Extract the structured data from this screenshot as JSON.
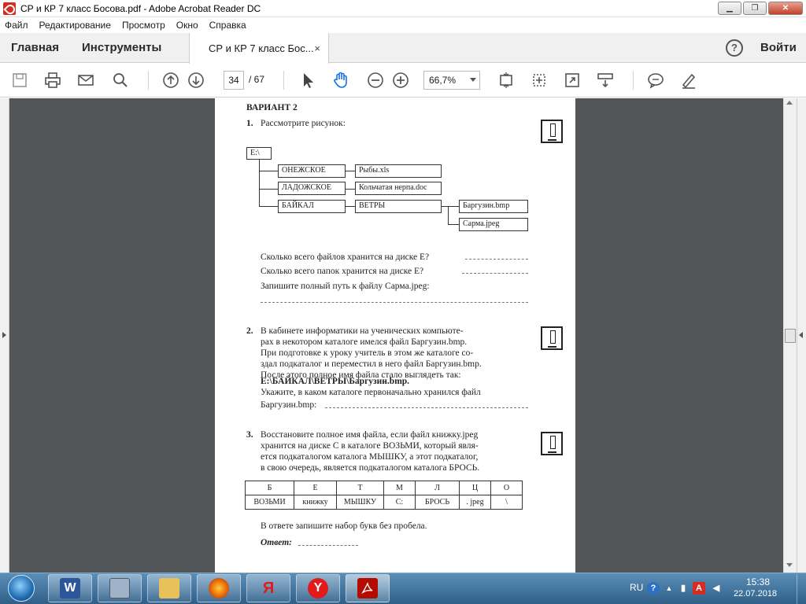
{
  "window": {
    "title": "СР и КР 7 класс Босова.pdf - Adobe Acrobat Reader DC"
  },
  "menu": [
    "Файл",
    "Редактирование",
    "Просмотр",
    "Окно",
    "Справка"
  ],
  "nav": {
    "home": "Главная",
    "tools": "Инструменты",
    "tab": "СР и КР 7 класс Бос...",
    "tab_close": "×",
    "help": "?",
    "signin": "Войти"
  },
  "toolbar": {
    "page_current": "34",
    "page_total": "/ 67",
    "zoom": "66,7%"
  },
  "doc": {
    "variant": "ВАРИАНТ  2",
    "q1": {
      "num": "1.",
      "text": "Рассмотрите рисунок:",
      "tree": {
        "root": "E:\\",
        "folders": [
          "ОНЕЖСКОЕ",
          "ЛАДОЖСКОЕ",
          "БАЙКАЛ"
        ],
        "files": [
          "Рыбы.xls",
          "Кольчатая нерпа.doc"
        ],
        "subfolder": "ВЕТРЫ",
        "subfiles": [
          "Баргузин.bmp",
          "Сарма.jpeg"
        ]
      },
      "lines": [
        "Сколько всего файлов хранится на диске E?",
        "Сколько всего папок хранится на диске E?",
        "Запишите полный путь к файлу Сарма.jpeg:"
      ]
    },
    "q2": {
      "num": "2.",
      "lines": [
        "В кабинете информатики на ученических компьюте-",
        "рах в некотором каталоге имелся файл Баргузин.bmp.",
        "При подготовке к уроку учитель в этом же каталоге со-",
        "здал подкаталог и переместил в него файл Баргузин.bmp.",
        "После этого полное имя файла стало выглядеть так:",
        "E:\\БАЙКАЛ\\ВЕТРЫ\\Баргузин.bmp.",
        "Укажите, в каком каталоге первоначально хранился файл",
        "Баргузин.bmp:"
      ]
    },
    "q3": {
      "num": "3.",
      "lines": [
        "Восстановите полное имя файла, если файл книжку.jpeg",
        "хранится на диске С в каталоге ВОЗЬМИ, который явля-",
        "ется подкаталогом каталога МЫШКУ, а этот подкаталог,",
        "в свою очередь, является подкаталогом каталога БРОСЬ."
      ],
      "table_letters": [
        "Б",
        "Е",
        "Т",
        "М",
        "Л",
        "Ц",
        "О"
      ],
      "table_values": [
        "ВОЗЬМИ",
        "книжку",
        "МЫШКУ",
        "С:",
        "БРОСЬ",
        ". jpeg",
        "\\"
      ],
      "answer_hint": "В ответе запишите набор букв без пробела.",
      "answer_label": "Ответ:"
    }
  },
  "taskbar": {
    "apps": [
      "start",
      "word",
      "computer",
      "explorer",
      "firefox",
      "yandex-browser-red",
      "yandex-browser",
      "acrobat"
    ],
    "yandex_red_letter": "Я",
    "yandex_letter": "Y",
    "tray_lang": "RU",
    "time": "15:38",
    "date": "22.07.2018"
  }
}
